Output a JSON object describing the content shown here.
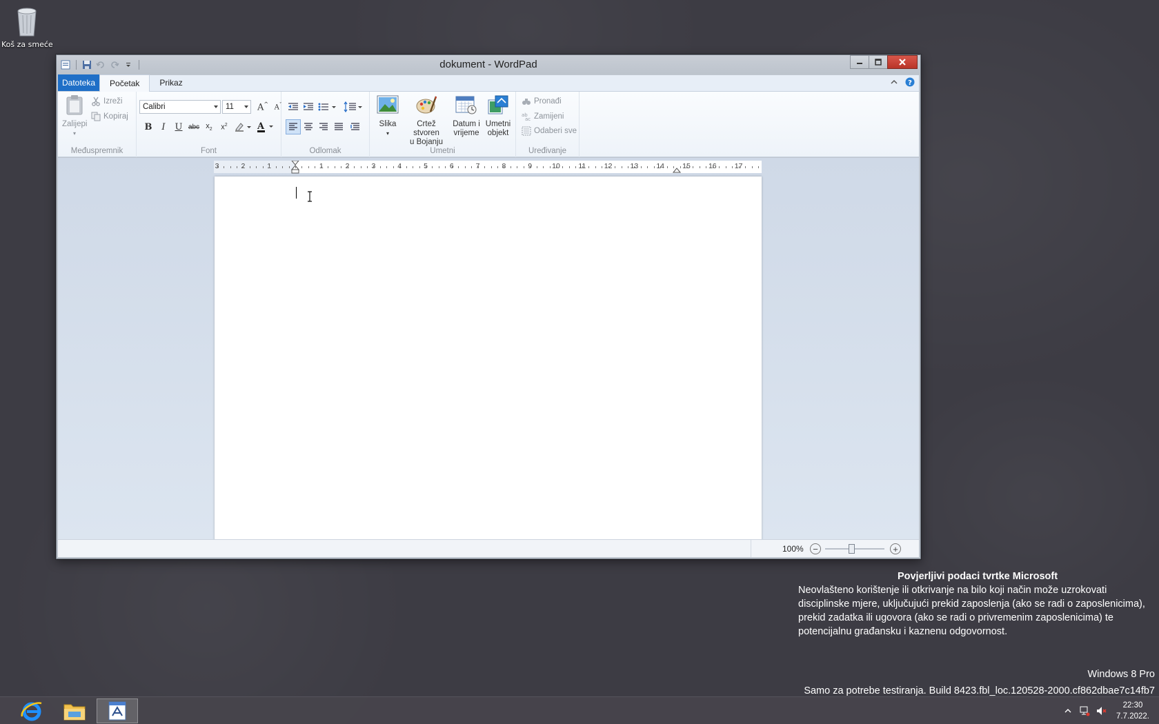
{
  "desktop": {
    "recycle_bin_label": "Koš za smeće"
  },
  "window": {
    "title": "dokument - WordPad"
  },
  "ribbon": {
    "tabs": [
      {
        "label": "Datoteka"
      },
      {
        "label": "Početak"
      },
      {
        "label": "Prikaz"
      }
    ],
    "clipboard": {
      "group_label": "Međuspremnik",
      "paste": "Zalijepi",
      "cut": "Izreži",
      "copy": "Kopiraj"
    },
    "font": {
      "group_label": "Font",
      "family": "Calibri",
      "size": "11"
    },
    "paragraph": {
      "group_label": "Odlomak"
    },
    "insert": {
      "group_label": "Umetni",
      "picture_label": "Slika",
      "paint_line1": "Crtež stvoren",
      "paint_line2": "u Bojanju",
      "datetime_line1": "Datum i",
      "datetime_line2": "vrijeme",
      "object_line1": "Umetni",
      "object_line2": "objekt"
    },
    "editing": {
      "group_label": "Uređivanje",
      "find": "Pronađi",
      "replace": "Zamijeni",
      "select_all": "Odaberi sve"
    }
  },
  "ruler": {
    "labels": [
      "3",
      "2",
      "1",
      "1",
      "2",
      "3",
      "4",
      "5",
      "6",
      "7",
      "8",
      "9",
      "10",
      "11",
      "12",
      "13",
      "14",
      "15",
      "16",
      "17"
    ]
  },
  "statusbar": {
    "zoom": "100%"
  },
  "notice": {
    "title": "Povjerljivi podaci tvrtke Microsoft",
    "body": "Neovlašteno korištenje ili otkrivanje na bilo koji način može uzrokovati disciplinske mjere, uključujući prekid zaposlenja (ako se radi o zaposlenicima), prekid zadatka ili ugovora (ako se radi o privremenim zaposlenicima) te potencijalnu građansku i kaznenu odgovornost.",
    "edition": "Windows 8 Pro",
    "build": "Samo za potrebe testiranja. Build 8423.fbl_loc.120528-2000.cf862dbae7c14fb7"
  },
  "taskbar": {
    "time": "22:30",
    "date": "7.7.2022."
  }
}
